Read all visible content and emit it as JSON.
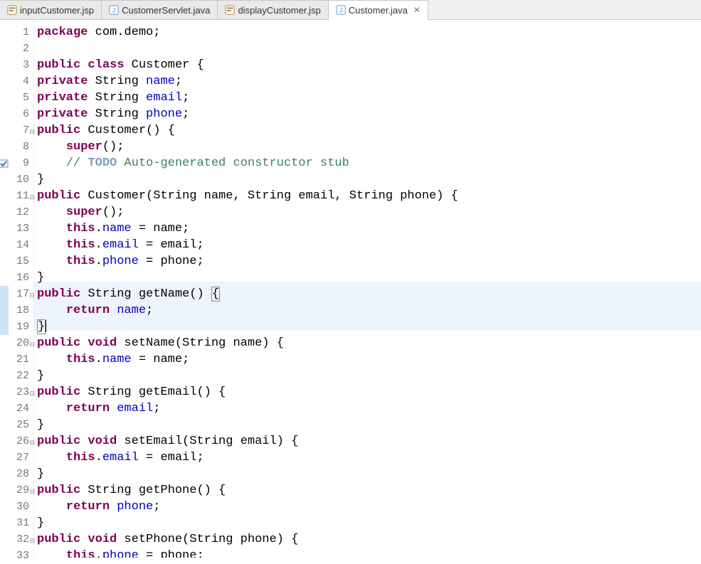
{
  "tabs": [
    {
      "label": "inputCustomer.jsp",
      "icon": "jsp",
      "active": false
    },
    {
      "label": "CustomerServlet.java",
      "icon": "java",
      "active": false
    },
    {
      "label": "displayCustomer.jsp",
      "icon": "jsp",
      "active": false
    },
    {
      "label": "Customer.java",
      "icon": "java",
      "active": true
    }
  ],
  "gutter": {
    "highlightStart": 17,
    "highlightEnd": 19
  },
  "lines": [
    {
      "n": 1,
      "tokens": [
        [
          "kw",
          "package"
        ],
        [
          "plain",
          " com.demo;"
        ]
      ]
    },
    {
      "n": 2,
      "tokens": []
    },
    {
      "n": 3,
      "tokens": [
        [
          "kw",
          "public"
        ],
        [
          "plain",
          " "
        ],
        [
          "kw",
          "class"
        ],
        [
          "plain",
          " Customer {"
        ]
      ]
    },
    {
      "n": 4,
      "tokens": [
        [
          "kw",
          "private"
        ],
        [
          "plain",
          " String "
        ],
        [
          "field",
          "name"
        ],
        [
          "plain",
          ";"
        ]
      ]
    },
    {
      "n": 5,
      "tokens": [
        [
          "kw",
          "private"
        ],
        [
          "plain",
          " String "
        ],
        [
          "field",
          "email"
        ],
        [
          "plain",
          ";"
        ]
      ]
    },
    {
      "n": 6,
      "tokens": [
        [
          "kw",
          "private"
        ],
        [
          "plain",
          " String "
        ],
        [
          "field",
          "phone"
        ],
        [
          "plain",
          ";"
        ]
      ]
    },
    {
      "n": 7,
      "fold": true,
      "tokens": [
        [
          "kw",
          "public"
        ],
        [
          "plain",
          " Customer() {"
        ]
      ]
    },
    {
      "n": 8,
      "tokens": [
        [
          "plain",
          "    "
        ],
        [
          "kw",
          "super"
        ],
        [
          "plain",
          "();"
        ]
      ]
    },
    {
      "n": 9,
      "marker": "task",
      "tokens": [
        [
          "plain",
          "    "
        ],
        [
          "comment",
          "// "
        ],
        [
          "todo",
          "TODO"
        ],
        [
          "comment",
          " Auto-generated constructor stub"
        ]
      ]
    },
    {
      "n": 10,
      "tokens": [
        [
          "plain",
          "}"
        ]
      ]
    },
    {
      "n": 11,
      "fold": true,
      "tokens": [
        [
          "kw",
          "public"
        ],
        [
          "plain",
          " Customer(String name, String email, String phone) {"
        ]
      ]
    },
    {
      "n": 12,
      "tokens": [
        [
          "plain",
          "    "
        ],
        [
          "kw",
          "super"
        ],
        [
          "plain",
          "();"
        ]
      ]
    },
    {
      "n": 13,
      "tokens": [
        [
          "plain",
          "    "
        ],
        [
          "kw",
          "this"
        ],
        [
          "plain",
          "."
        ],
        [
          "field",
          "name"
        ],
        [
          "plain",
          " = name;"
        ]
      ]
    },
    {
      "n": 14,
      "tokens": [
        [
          "plain",
          "    "
        ],
        [
          "kw",
          "this"
        ],
        [
          "plain",
          "."
        ],
        [
          "field",
          "email"
        ],
        [
          "plain",
          " = email;"
        ]
      ]
    },
    {
      "n": 15,
      "tokens": [
        [
          "plain",
          "    "
        ],
        [
          "kw",
          "this"
        ],
        [
          "plain",
          "."
        ],
        [
          "field",
          "phone"
        ],
        [
          "plain",
          " = phone;"
        ]
      ]
    },
    {
      "n": 16,
      "tokens": [
        [
          "plain",
          "}"
        ]
      ]
    },
    {
      "n": 17,
      "fold": true,
      "hl": true,
      "tokens": [
        [
          "kw",
          "public"
        ],
        [
          "plain",
          " String getName() "
        ],
        [
          "boxbrace",
          "{"
        ]
      ]
    },
    {
      "n": 18,
      "hl": true,
      "tokens": [
        [
          "plain",
          "    "
        ],
        [
          "kw",
          "return"
        ],
        [
          "plain",
          " "
        ],
        [
          "field",
          "name"
        ],
        [
          "plain",
          ";"
        ]
      ]
    },
    {
      "n": 19,
      "hl": true,
      "caret": true,
      "tokens": [
        [
          "boxbrace",
          "}"
        ]
      ]
    },
    {
      "n": 20,
      "fold": true,
      "tokens": [
        [
          "kw",
          "public"
        ],
        [
          "plain",
          " "
        ],
        [
          "kw",
          "void"
        ],
        [
          "plain",
          " setName(String name) {"
        ]
      ]
    },
    {
      "n": 21,
      "tokens": [
        [
          "plain",
          "    "
        ],
        [
          "kw",
          "this"
        ],
        [
          "plain",
          "."
        ],
        [
          "field",
          "name"
        ],
        [
          "plain",
          " = name;"
        ]
      ]
    },
    {
      "n": 22,
      "tokens": [
        [
          "plain",
          "}"
        ]
      ]
    },
    {
      "n": 23,
      "fold": true,
      "tokens": [
        [
          "kw",
          "public"
        ],
        [
          "plain",
          " String getEmail() {"
        ]
      ]
    },
    {
      "n": 24,
      "tokens": [
        [
          "plain",
          "    "
        ],
        [
          "kw",
          "return"
        ],
        [
          "plain",
          " "
        ],
        [
          "field",
          "email"
        ],
        [
          "plain",
          ";"
        ]
      ]
    },
    {
      "n": 25,
      "tokens": [
        [
          "plain",
          "}"
        ]
      ]
    },
    {
      "n": 26,
      "fold": true,
      "tokens": [
        [
          "kw",
          "public"
        ],
        [
          "plain",
          " "
        ],
        [
          "kw",
          "void"
        ],
        [
          "plain",
          " setEmail(String email) {"
        ]
      ]
    },
    {
      "n": 27,
      "tokens": [
        [
          "plain",
          "    "
        ],
        [
          "kw",
          "this"
        ],
        [
          "plain",
          "."
        ],
        [
          "field",
          "email"
        ],
        [
          "plain",
          " = email;"
        ]
      ]
    },
    {
      "n": 28,
      "tokens": [
        [
          "plain",
          "}"
        ]
      ]
    },
    {
      "n": 29,
      "fold": true,
      "tokens": [
        [
          "kw",
          "public"
        ],
        [
          "plain",
          " String getPhone() {"
        ]
      ]
    },
    {
      "n": 30,
      "tokens": [
        [
          "plain",
          "    "
        ],
        [
          "kw",
          "return"
        ],
        [
          "plain",
          " "
        ],
        [
          "field",
          "phone"
        ],
        [
          "plain",
          ";"
        ]
      ]
    },
    {
      "n": 31,
      "tokens": [
        [
          "plain",
          "}"
        ]
      ]
    },
    {
      "n": 32,
      "fold": true,
      "tokens": [
        [
          "kw",
          "public"
        ],
        [
          "plain",
          " "
        ],
        [
          "kw",
          "void"
        ],
        [
          "plain",
          " setPhone(String phone) {"
        ]
      ]
    },
    {
      "n": 33,
      "partial": true,
      "tokens": [
        [
          "plain",
          "    "
        ],
        [
          "kw",
          "this"
        ],
        [
          "plain",
          "."
        ],
        [
          "field",
          "phone"
        ],
        [
          "plain",
          " = phone;"
        ]
      ]
    }
  ]
}
